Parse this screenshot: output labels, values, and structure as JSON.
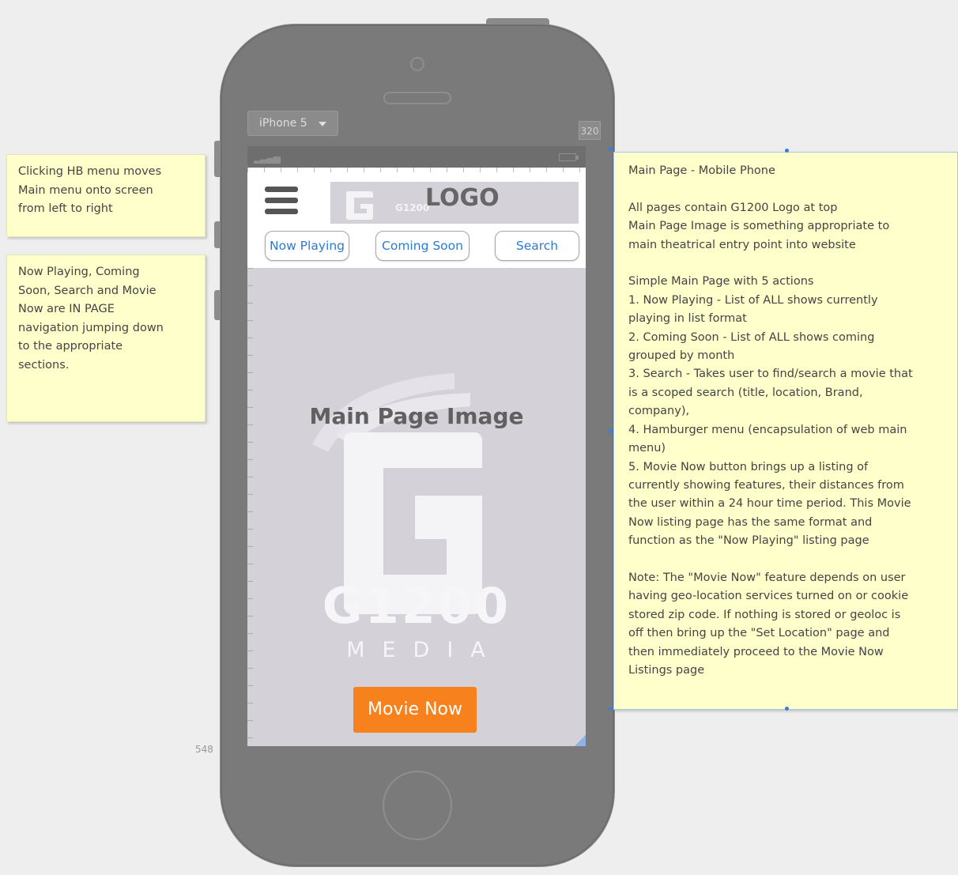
{
  "notes": {
    "hb_menu": "Clicking HB menu moves\nMain menu onto screen\nfrom left to right",
    "in_page_nav": "Now Playing, Coming\nSoon, Search and Movie\nNow are IN PAGE\nnavigation jumping down\nto the appropriate\nsections.",
    "main_page": "Main Page - Mobile Phone\n\nAll pages contain G1200 Logo at top\nMain Page Image is something appropriate to\nmain theatrical entry point into website\n\nSimple Main Page with 5 actions\n1. Now Playing - List of ALL shows currently\nplaying in list format\n2. Coming Soon - List of ALL shows coming\ngrouped by month\n3. Search - Takes user to find/search a movie that\nis a scoped search (title, location, Brand,\ncompany),\n4. Hamburger menu (encapsulation of web main\nmenu)\n5. Movie Now button brings up a listing of\ncurrently showing features, their distances from\nthe user within a 24 hour time period. This Movie\nNow listing page has the same format and\nfunction as the \"Now Playing\" listing page\n\nNote: The \"Movie Now\" feature depends on user\nhaving geo-location services turned on or cookie\nstored zip code. If nothing is stored or geoloc is\noff then bring up the \"Set Location\" page and\nthen immediately proceed to the Movie Now\nListings page"
  },
  "device": {
    "selected": "iPhone 5",
    "width_label": "320",
    "height_label": "548"
  },
  "header": {
    "logo_text": "LOGO",
    "logo_mini": "G1200",
    "nav": {
      "now_playing": "Now Playing",
      "coming_soon": "Coming Soon",
      "search": "Search"
    }
  },
  "hero": {
    "label": "Main Page Image",
    "brand_name": "G1200",
    "brand_sub": "MEDIA"
  },
  "cta": {
    "movie_now": "Movie Now"
  },
  "colors": {
    "note_bg": "#ffffcc",
    "phone_body": "#7a7a7a",
    "screen_bg": "#d4d1d9",
    "link_blue": "#2f7ad0",
    "cta_orange": "#f7811d"
  }
}
